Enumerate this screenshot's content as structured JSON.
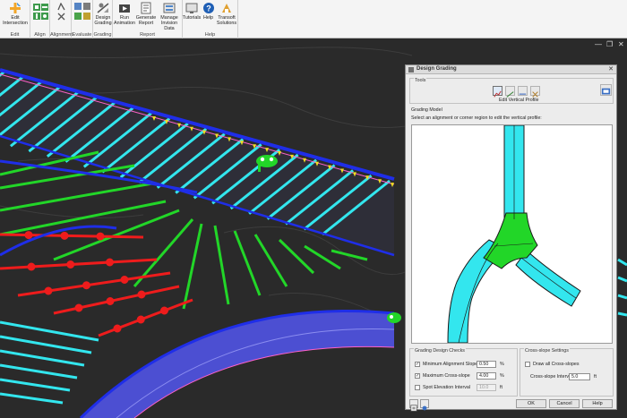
{
  "ribbon": {
    "groups": [
      {
        "label": "Edit",
        "buttons": [
          {
            "label": "Edit\nIntersection",
            "icon": "edit-intersection-icon"
          }
        ]
      },
      {
        "label": "Align",
        "buttons": []
      },
      {
        "label": "Alignment",
        "buttons": []
      },
      {
        "label": "Evaluate",
        "buttons": []
      },
      {
        "label": "Grading",
        "buttons": [
          {
            "label": "Design\nGrading",
            "icon": "design-grading-icon"
          }
        ]
      },
      {
        "label": "Report",
        "buttons": [
          {
            "label": "Run\nAnimation",
            "icon": "run-animation-icon"
          },
          {
            "label": "Generate\nReport",
            "icon": "generate-report-icon"
          },
          {
            "label": "Manage\nInvision Data",
            "icon": "manage-invision-data-icon"
          }
        ]
      },
      {
        "label": "Help",
        "buttons": [
          {
            "label": "Tutorials",
            "icon": "tutorials-icon"
          },
          {
            "label": "Help",
            "icon": "help-icon"
          },
          {
            "label": "Transoft\nSolutions",
            "icon": "transoft-solutions-icon"
          }
        ]
      }
    ]
  },
  "viewport": {
    "controls": {
      "minimize": "—",
      "restore": "❐",
      "close": "✕"
    },
    "background_color": "#2a2a2a",
    "colors": {
      "cyan": "#33e6ee",
      "green": "#22d628",
      "red": "#ee1c1c",
      "blue": "#1f2ee8",
      "yellow": "#f0e020",
      "pink": "#ff60c8"
    }
  },
  "dialog": {
    "title": "Design Grading",
    "close": "✕",
    "tools_label": "Tools",
    "edit_vertical_profile": "Edit Vertical Profile",
    "grading_model_label": "Grading Model",
    "instruction": "Select an alignment or corner region to edit the vertical profile:",
    "checks_label": "Grading Design Checks",
    "checks": [
      {
        "label": "Minimum Alignment Slope",
        "value": "0.50",
        "unit": "%",
        "checked": true
      },
      {
        "label": "Maximum Cross-slope",
        "value": "4.00",
        "unit": "%",
        "checked": true
      },
      {
        "label": "Spot Elevation Interval",
        "value": "10.0",
        "unit": "ft",
        "checked": false
      }
    ],
    "cross_slope_label": "Cross-slope Settings",
    "draw_all_label": "Draw all Cross-slopes",
    "interval_label": "Cross-slope Interval",
    "interval_value": "5.0",
    "interval_unit": "ft",
    "buttons": {
      "ok": "OK",
      "cancel": "Cancel",
      "help": "Help"
    },
    "checked_glyph": "✓"
  }
}
